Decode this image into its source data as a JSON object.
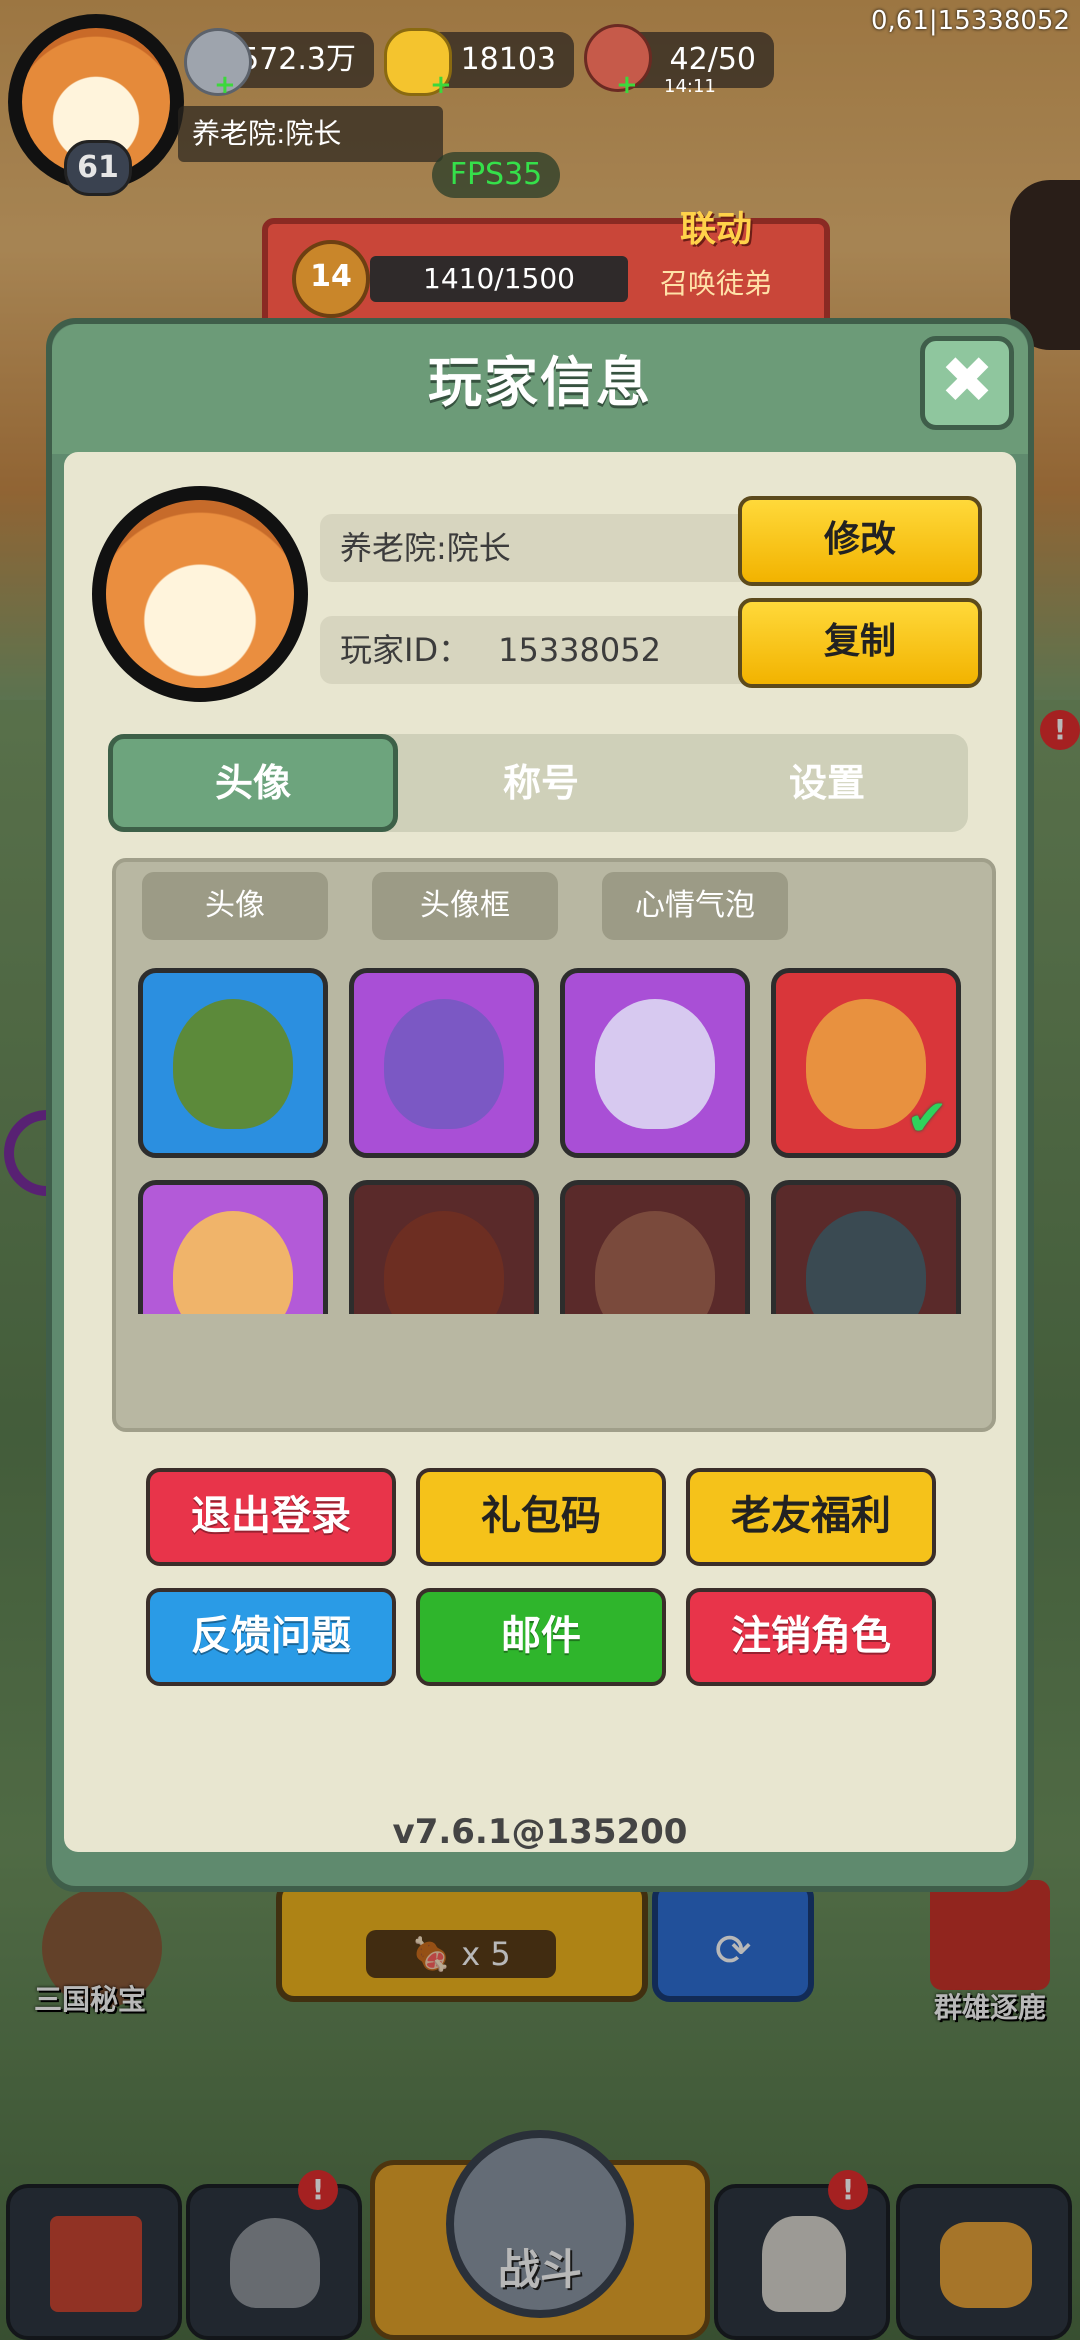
{
  "hud": {
    "level": "61",
    "silver": "572.3万",
    "gold": "18103",
    "stamina": "42/50",
    "stamina_timer": "14:11",
    "player_name": "养老院:院长",
    "fps": "FPS35",
    "coord_readout": "0,61|15338052"
  },
  "event_banner": {
    "title": "联动",
    "level": "14",
    "progress_text": "1410/1500",
    "subtitle": "召唤徒弟"
  },
  "modal": {
    "title": "玩家信息",
    "close_label": "✖",
    "name_value": "养老院:院长",
    "id_label": "玩家ID：",
    "id_value": "15338052",
    "edit_button": "修改",
    "copy_button": "复制",
    "tabs": [
      "头像",
      "称号",
      "设置"
    ],
    "active_tab": "头像",
    "subtabs": [
      "头像",
      "头像框",
      "心情气泡"
    ],
    "avatars": [
      {
        "icon": "warrior-avatar",
        "frame": "#2b8fe0",
        "char": "#5c8a3a",
        "selected": false
      },
      {
        "icon": "queen-avatar",
        "frame": "#a94fd6",
        "char": "#7b58c4",
        "selected": false
      },
      {
        "icon": "unicorn-avatar",
        "frame": "#a94fd6",
        "char": "#d7c9f0",
        "selected": false
      },
      {
        "icon": "corgi-avatar",
        "frame": "#d9363a",
        "char": "#e8913f",
        "selected": true
      },
      {
        "icon": "lucky-cat-avatar",
        "frame": "#b35ad8",
        "char": "#f0b46a",
        "selected": false
      },
      {
        "icon": "helmet-warrior-avatar",
        "frame": "#5a2a2a",
        "char": "#6d2e22",
        "selected": false
      },
      {
        "icon": "white-cat-avatar",
        "frame": "#5a2a2a",
        "char": "#7a4a3c",
        "selected": false
      },
      {
        "icon": "dragon-avatar",
        "frame": "#5a2a2a",
        "char": "#3a4a52",
        "selected": false
      }
    ],
    "actions": [
      {
        "label": "退出登录",
        "color": "#e8344a"
      },
      {
        "label": "礼包码",
        "color": "#f5c21a"
      },
      {
        "label": "老友福利",
        "color": "#f5c21a"
      },
      {
        "label": "反馈问题",
        "color": "#2a9be6"
      },
      {
        "label": "邮件",
        "color": "#2fb52c"
      },
      {
        "label": "注销角色",
        "color": "#e8344a"
      }
    ],
    "version": "v7.6.1@135200"
  },
  "background": {
    "left_label": "三国秘宝",
    "right_label": "群雄逐鹿",
    "fight_cost": "x 5",
    "nav_fight_label": "战斗",
    "alert_badge": "!"
  }
}
